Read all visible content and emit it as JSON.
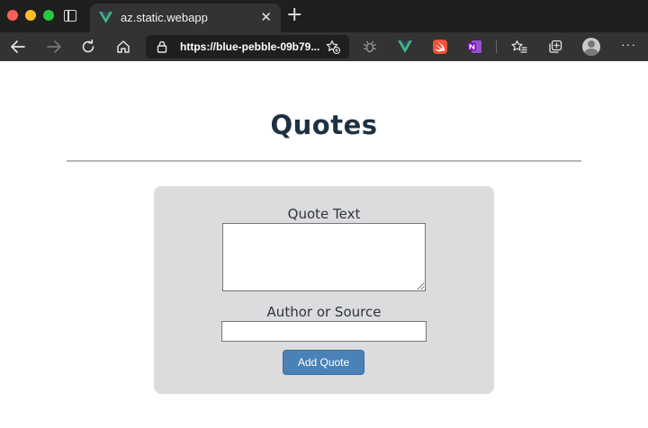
{
  "browser": {
    "tab": {
      "title": "az.static.webapp",
      "close_glyph": "✕",
      "favicon": "vue-icon"
    },
    "new_tab_glyph": "+",
    "address": {
      "url": "https://blue-pebble-09b79..."
    },
    "more_glyph": "···",
    "icons": [
      "back-icon",
      "forward-icon",
      "refresh-icon",
      "home-icon",
      "lock-icon",
      "add-favorite-icon",
      "bug-extension-icon",
      "vue-devtools-icon",
      "swift-extension-icon",
      "onenote-icon",
      "favorites-icon",
      "collections-icon",
      "profile-avatar-icon"
    ]
  },
  "page": {
    "title": "Quotes",
    "form": {
      "quote_label": "Quote Text",
      "quote_value": "",
      "author_label": "Author or Source",
      "author_value": "",
      "submit_label": "Add Quote"
    }
  },
  "colors": {
    "title": "#1e3142",
    "card_bg": "#dcdbdd",
    "button_bg": "#4a82b8",
    "chrome_bg": "#333333",
    "vue_green": "#41b883"
  }
}
